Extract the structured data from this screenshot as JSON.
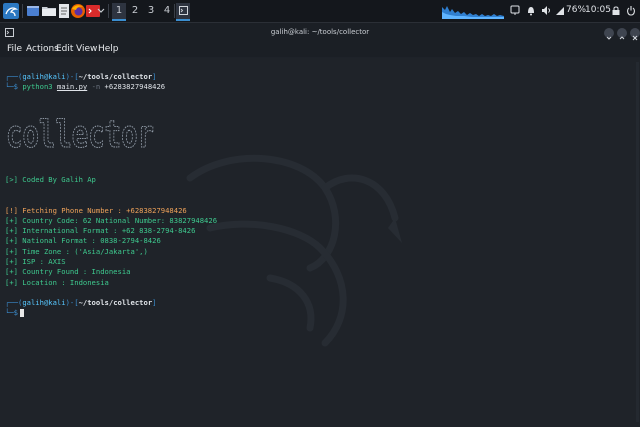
{
  "colors": {
    "accent_blue": "#3b8ed0",
    "output_green": "#3ec98e",
    "warning_orange": "#f0a35a",
    "background": "#1f2329"
  },
  "taskbar": {
    "workspaces": [
      "1",
      "2",
      "3",
      "4"
    ],
    "active_workspace": "1",
    "battery": "76%",
    "clock": "10:05",
    "icons": [
      "kali-menu-icon",
      "show-desktop-icon",
      "file-manager-icon",
      "text-editor-icon",
      "firefox-icon",
      "terminal-emulator-icon",
      "chevron-down-icon",
      "terminal-window-icon",
      "monitor-icon",
      "bell-icon",
      "volume-icon",
      "network-icon",
      "lock-icon",
      "power-icon"
    ]
  },
  "window": {
    "title": "galih@kali: ~/tools/collector"
  },
  "menu": {
    "items": [
      "File",
      "Actions",
      "Edit",
      "View",
      "Help"
    ]
  },
  "terminal": {
    "prompt1": {
      "user": "galih",
      "at": "@",
      "host": "kali",
      "path": "~/tools/collector",
      "command": "python3",
      "script": "main.py",
      "flag": "-n",
      "arg": "+6283827948426"
    },
    "banner": "collector",
    "coded_by": "[>] Coded By Galih Ap",
    "fetching": "[!] Fetching Phone Number : +6283827948426",
    "results": [
      "[+] Country Code: 62 National Number: 83827948426",
      "[+] International Format : +62 838-2794-8426",
      "[+] National Format : 0838-2794-8426",
      "[+] Time Zone : ('Asia/Jakarta',)",
      "[+] ISP : AXIS",
      "[+] Country Found : Indonesia",
      "[+] Location : Indonesia"
    ],
    "prompt2": {
      "user": "galih",
      "at": "@",
      "host": "kali",
      "path": "~/tools/collector"
    }
  }
}
